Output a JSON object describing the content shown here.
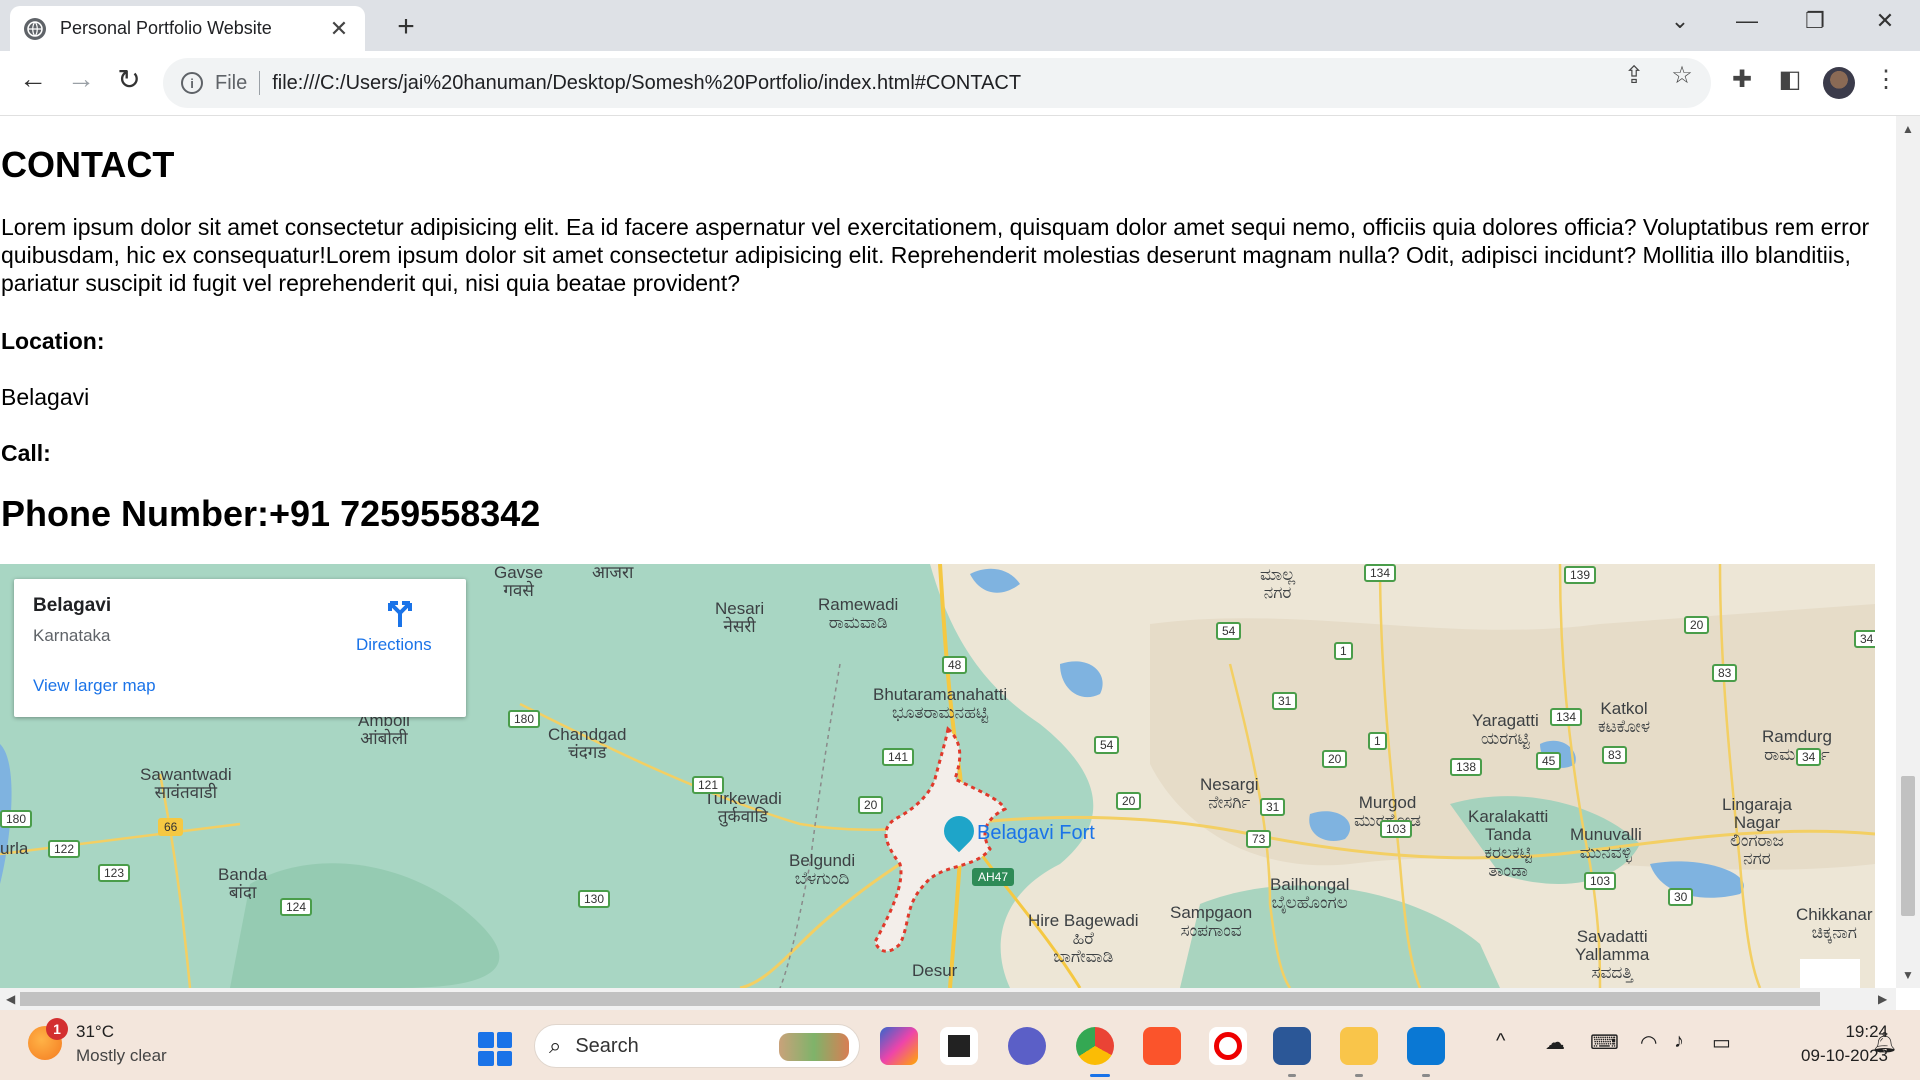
{
  "browser": {
    "tab_title": "Personal Portfolio Website",
    "omnibox_file_label": "File",
    "url": "file:///C:/Users/jai%20hanuman/Desktop/Somesh%20Portfolio/index.html#CONTACT"
  },
  "page": {
    "heading": "CONTACT",
    "paragraph": "Lorem ipsum dolor sit amet consectetur adipisicing elit. Ea id facere aspernatur vel exercitationem, quisquam dolor amet sequi nemo, officiis quia dolores officia? Voluptatibus rem error quibusdam, hic ex consequatur!Lorem ipsum dolor sit amet consectetur adipisicing elit. Reprehenderit molestias deserunt magnam nulla? Odit, adipisci incidunt? Mollitia illo blanditiis, pariatur suscipit id fugit vel reprehenderit qui, nisi quia beatae provident?",
    "location_label": "Location:",
    "location_value": "Belagavi",
    "call_label": "Call:",
    "phone": "Phone Number:+91 7259558342"
  },
  "map": {
    "card_title": "Belagavi",
    "card_subtitle": "Karnataka",
    "directions_label": "Directions",
    "larger_map_link": "View larger map",
    "fort_label": "Belagavi Fort",
    "places": [
      {
        "id": "nesari",
        "text": "Nesari\nनेसरी"
      },
      {
        "id": "ramewadi",
        "text": "Ramewadi\nರಾಮವಾಡಿ"
      },
      {
        "id": "bhutaramanahatti",
        "text": "Bhutaramanahatti\nಭೂತರಾಮನಹಟ್ಟಿ"
      },
      {
        "id": "chandgad",
        "text": "Chandgad\nचंदगड"
      },
      {
        "id": "amboli",
        "text": "Amboli\nआंबोली"
      },
      {
        "id": "sawantwadi",
        "text": "Sawantwadi\nसावंतवाडी"
      },
      {
        "id": "turkewadi",
        "text": "Turkewadi\nतुर्कवाडि"
      },
      {
        "id": "belgundi",
        "text": "Belgundi\nಬೆಳಗುಂದಿ"
      },
      {
        "id": "banda",
        "text": "Banda\nबांदा"
      },
      {
        "id": "nesargi",
        "text": "Nesargi\nನೇಸರ್ಗಿ"
      },
      {
        "id": "murgod",
        "text": "Murgod\nಮುರಗೋಡ"
      },
      {
        "id": "yaragatti",
        "text": "Yaragatti\nಯರಗಟ್ಟಿ"
      },
      {
        "id": "katkol",
        "text": "Katkol\nಕಟಕೋಳ"
      },
      {
        "id": "ramdurg",
        "text": "Ramdurg\nರಾಮದುರ್ಗ"
      },
      {
        "id": "karalakatti",
        "text": "Karalakatti\nTanda\nಕರಲಕಟ್ಟಿ\nತಾಂಡಾ"
      },
      {
        "id": "munuvalli",
        "text": "Munuvalli\nಮುನವಳ್ಳಿ"
      },
      {
        "id": "lingaraja",
        "text": "Lingaraja\nNagar\nಲಿಂಗರಾಜ\nನಗರ"
      },
      {
        "id": "bailhongal",
        "text": "Bailhongal\nಬೈಲಹೊಂಗಲ"
      },
      {
        "id": "sampgaon",
        "text": "Sampgaon\nಸಂಪಗಾಂವ"
      },
      {
        "id": "hirebagewadi",
        "text": "Hire Bagewadi\nಹಿರೆ\nಬಾಗೇವಾಡಿ"
      },
      {
        "id": "savadatti",
        "text": "Savadatti\nYallamma\nಸವದತ್ತಿ"
      },
      {
        "id": "chikkanar",
        "text": "Chikkanar\nಚಿಕ್ಕನಾಗ"
      },
      {
        "id": "desur",
        "text": "Desur"
      },
      {
        "id": "malli",
        "text": "ಮಾಲ್ಲ\nನಗರ"
      },
      {
        "id": "gavse",
        "text": "Gavse\nगवसे"
      },
      {
        "id": "ajra",
        "text": "आजरा"
      },
      {
        "id": "urla",
        "text": "urla"
      }
    ],
    "shields": [
      {
        "id": "s48",
        "text": "48"
      },
      {
        "id": "s54a",
        "text": "54"
      },
      {
        "id": "s1a",
        "text": "1"
      },
      {
        "id": "s31",
        "text": "31"
      },
      {
        "id": "s1b",
        "text": "1"
      },
      {
        "id": "s20a",
        "text": "20"
      },
      {
        "id": "s20b",
        "text": "20"
      },
      {
        "id": "s139",
        "text": "139"
      },
      {
        "id": "s134a",
        "text": "134"
      },
      {
        "id": "s134b",
        "text": "134"
      },
      {
        "id": "s83a",
        "text": "83"
      },
      {
        "id": "s83b",
        "text": "83"
      },
      {
        "id": "s34a",
        "text": "34"
      },
      {
        "id": "s34b",
        "text": "34"
      },
      {
        "id": "s45",
        "text": "45"
      },
      {
        "id": "s138",
        "text": "138"
      },
      {
        "id": "s103a",
        "text": "103"
      },
      {
        "id": "s103b",
        "text": "103"
      },
      {
        "id": "s30",
        "text": "30"
      },
      {
        "id": "s73",
        "text": "73"
      },
      {
        "id": "s31b",
        "text": "31"
      },
      {
        "id": "s20c",
        "text": "20"
      },
      {
        "id": "s54b",
        "text": "54"
      },
      {
        "id": "s141",
        "text": "141"
      },
      {
        "id": "s20d",
        "text": "20"
      },
      {
        "id": "sAH47",
        "text": "AH47"
      },
      {
        "id": "s121",
        "text": "121"
      },
      {
        "id": "s180a",
        "text": "180"
      },
      {
        "id": "s180b",
        "text": "180"
      },
      {
        "id": "s66",
        "text": "66"
      },
      {
        "id": "s122",
        "text": "122"
      },
      {
        "id": "s123",
        "text": "123"
      },
      {
        "id": "s124",
        "text": "124"
      },
      {
        "id": "s130",
        "text": "130"
      }
    ]
  },
  "taskbar": {
    "weather_badge": "1",
    "temperature": "31°C",
    "condition": "Mostly clear",
    "search_placeholder": "Search",
    "time": "19:24",
    "date": "09-10-2023"
  },
  "colors": {
    "tabstrip": "#dee1e6",
    "omnibox": "#f1f3f4",
    "link_blue": "#1a73e8",
    "map_water_green": "#a8d6c3",
    "taskbar": "#f3e6dc"
  }
}
